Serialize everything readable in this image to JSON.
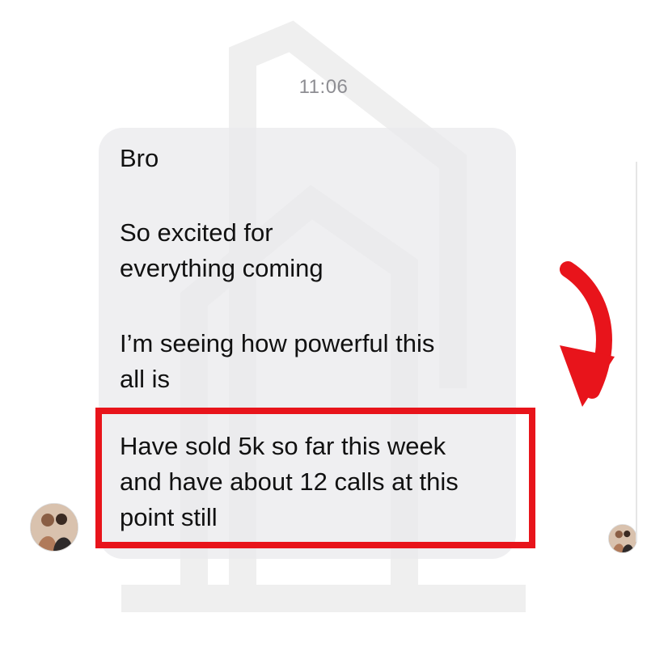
{
  "conversation": {
    "timestamp": "11:06",
    "messages": [
      "Bro",
      "So excited for\neverything coming",
      "I’m seeing how powerful this\nall is",
      "Have sold 5k so far this week\nand have about 12 calls at this\npoint still"
    ]
  },
  "annotation": {
    "highlight_color": "#e8141b",
    "arrow_icon": "curved-arrow-down-icon"
  },
  "avatars": {
    "left": "avatar-photo",
    "right": "avatar-photo"
  },
  "colors": {
    "bubble": "#e9e9eb",
    "timestamp": "#8e8e93",
    "text": "#111111",
    "watermark": "#f2f2f2"
  }
}
